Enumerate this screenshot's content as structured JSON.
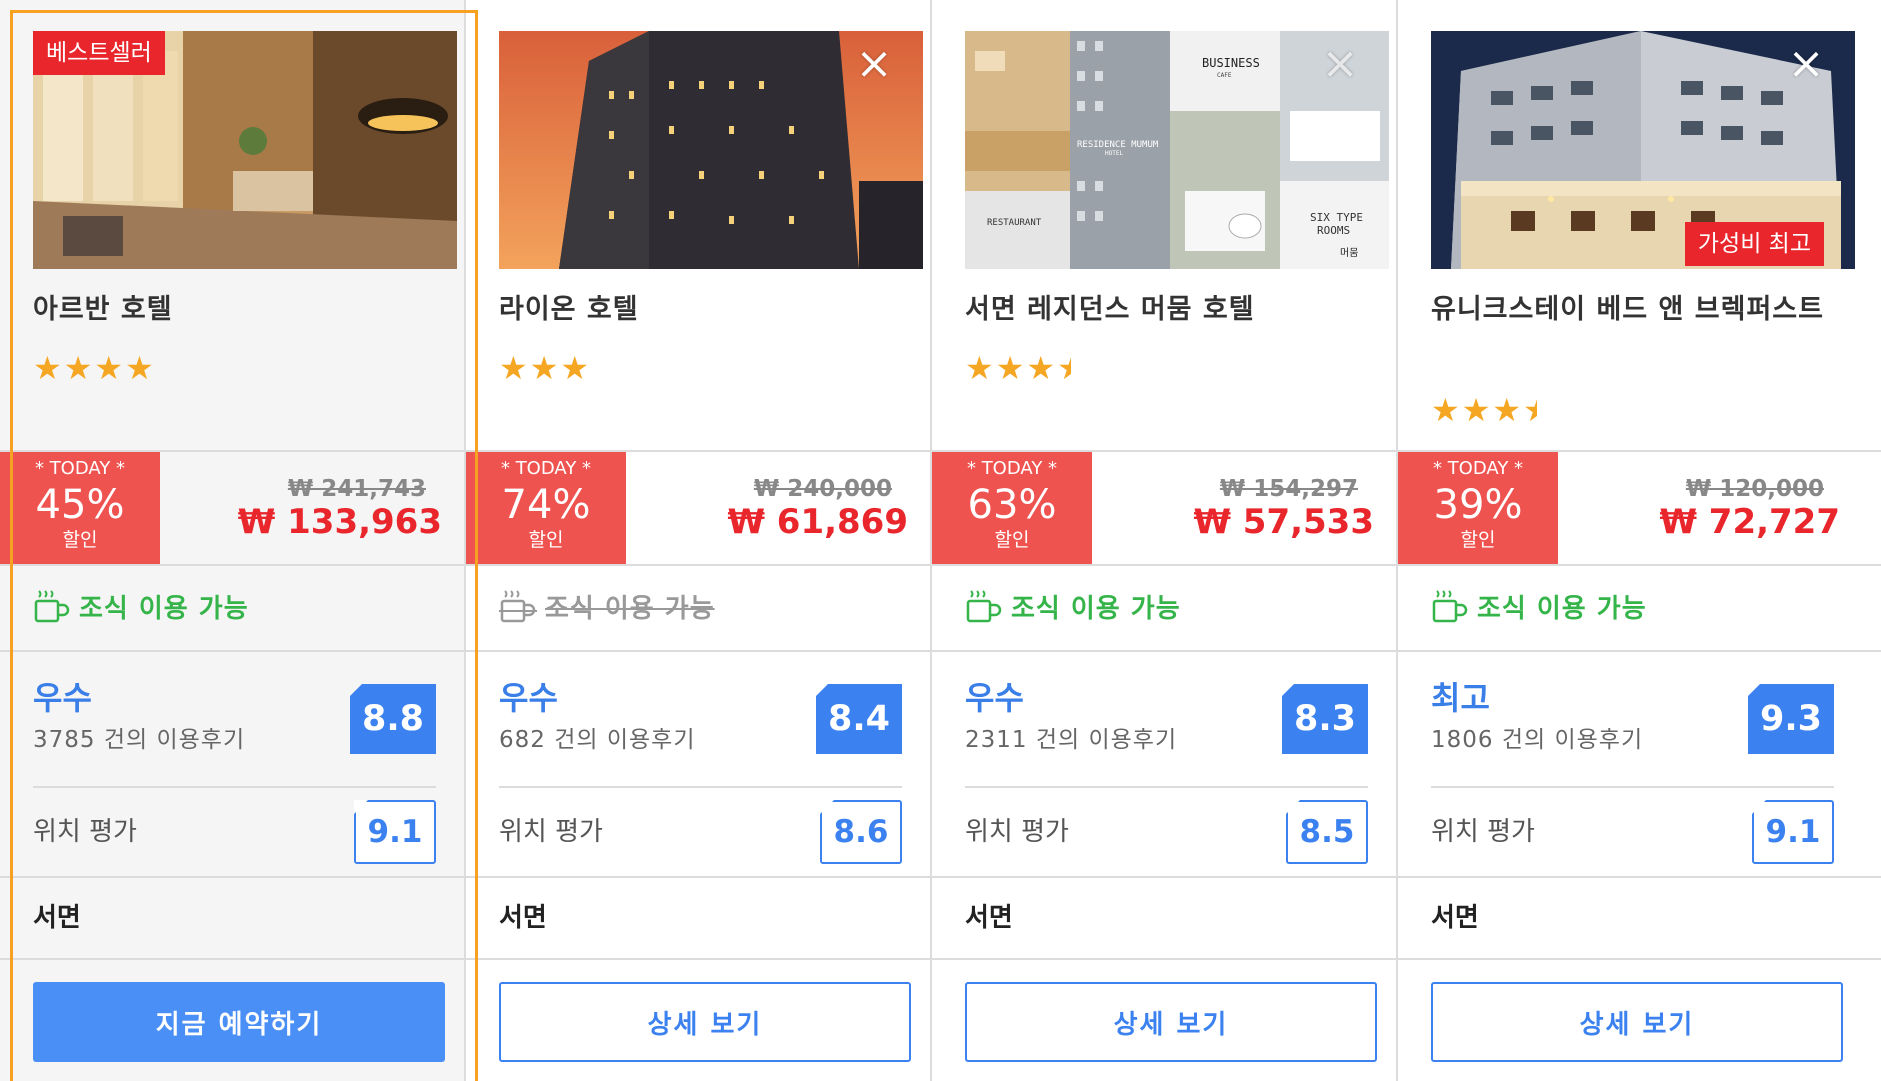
{
  "hotels": [
    {
      "badge": "베스트셀러",
      "name": "아르반 호텔",
      "stars": "★★★★",
      "star_half": "",
      "today_label": "* TODAY *",
      "discount": "45%",
      "discount_label": "할인",
      "original_price": "₩ 241,743",
      "price": "₩ 133,963",
      "breakfast": "조식 이용 가능",
      "breakfast_available": true,
      "rating_word": "우수",
      "reviews": "3785 건의 이용후기",
      "score": "8.8",
      "location_label": "위치 평가",
      "location_score": "9.1",
      "area": "서면",
      "button": "지금 예약하기"
    },
    {
      "name": "라이온 호텔",
      "stars": "★★★",
      "star_half": "",
      "today_label": "* TODAY *",
      "discount": "74%",
      "discount_label": "할인",
      "original_price": "₩ 240,000",
      "price": "₩ 61,869",
      "breakfast": "조식 이용 가능",
      "breakfast_available": false,
      "rating_word": "우수",
      "reviews": "682 건의 이용후기",
      "score": "8.4",
      "location_label": "위치 평가",
      "location_score": "8.6",
      "area": "서면",
      "button": "상세 보기"
    },
    {
      "name": "서면 레지던스 머뭄 호텔",
      "stars": "★★★",
      "star_half": "★",
      "today_label": "* TODAY *",
      "discount": "63%",
      "discount_label": "할인",
      "original_price": "₩ 154,297",
      "price": "₩ 57,533",
      "breakfast": "조식 이용 가능",
      "breakfast_available": true,
      "rating_word": "우수",
      "reviews": "2311 건의 이용후기",
      "score": "8.3",
      "location_label": "위치 평가",
      "location_score": "8.5",
      "area": "서면",
      "button": "상세 보기",
      "photo_texts": {
        "business": "BUSINESS",
        "cafe": "CAFE",
        "residence": "RESIDENCE MUMUM",
        "hotel": "HOTEL",
        "restaurant": "RESTAURANT",
        "six_type": "SIX TYPE",
        "rooms": "ROOMS",
        "brand": "머뭄"
      }
    },
    {
      "badge": "가성비 최고",
      "name": "유니크스테이 베드 앤 브렉퍼스트",
      "stars": "★★★",
      "star_half": "★",
      "today_label": "* TODAY *",
      "discount": "39%",
      "discount_label": "할인",
      "original_price": "₩ 120,000",
      "price": "₩ 72,727",
      "breakfast": "조식 이용 가능",
      "breakfast_available": true,
      "rating_word": "최고",
      "reviews": "1806 건의 이용후기",
      "score": "9.3",
      "location_label": "위치 평가",
      "location_score": "9.1",
      "area": "서면",
      "button": "상세 보기"
    }
  ],
  "close_icon": "×",
  "colors": {
    "featured_border": "#f7a123",
    "discount_bg": "#ef5350",
    "price_red": "#e8262c",
    "rating_blue": "#3b82f0",
    "breakfast_green": "#35b44a",
    "star_orange": "#f5a623"
  }
}
